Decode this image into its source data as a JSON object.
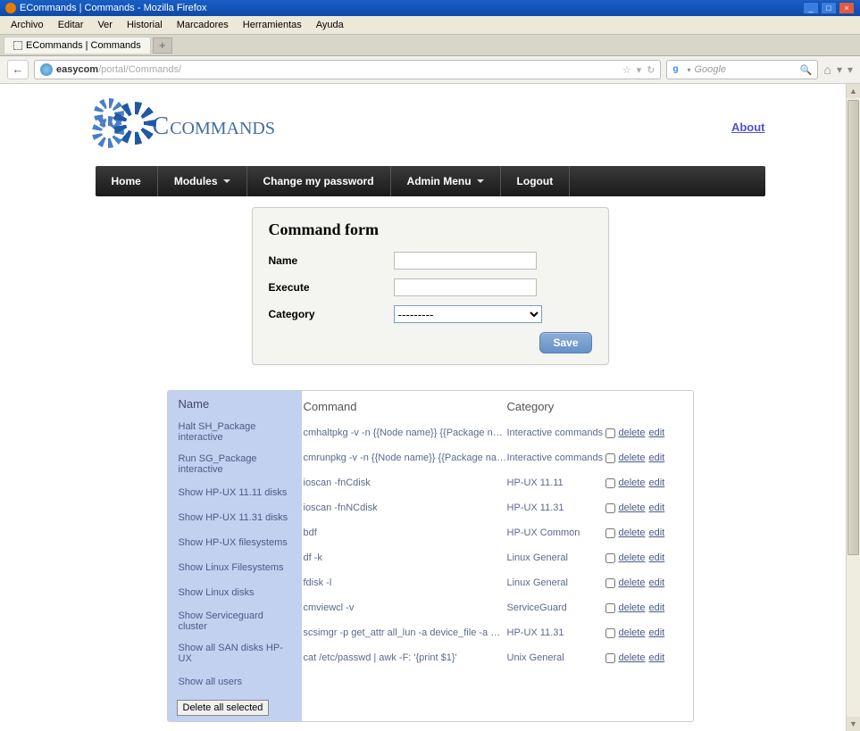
{
  "window": {
    "title": "ECommands | Commands - Mozilla Firefox"
  },
  "menubar": [
    "Archivo",
    "Editar",
    "Ver",
    "Historial",
    "Marcadores",
    "Herramientas",
    "Ayuda"
  ],
  "tab": {
    "title": "ECommands | Commands"
  },
  "url": {
    "host": "easycom",
    "path": "/portal/Commands/"
  },
  "search": {
    "placeholder": "Google"
  },
  "about": "About",
  "logo_text": "Commands",
  "nav": {
    "home": "Home",
    "modules": "Modules",
    "change_pw": "Change my password",
    "admin": "Admin Menu",
    "logout": "Logout"
  },
  "form": {
    "title": "Command form",
    "name_label": "Name",
    "execute_label": "Execute",
    "category_label": "Category",
    "select_default": "---------",
    "save": "Save"
  },
  "table": {
    "hdr_name": "Name",
    "hdr_cmd": "Command",
    "hdr_cat": "Category",
    "delete": "delete",
    "edit": "edit",
    "delete_selected": "Delete all selected",
    "rows": [
      {
        "name": "Halt SH_Package interactive",
        "cmd": "cmhaltpkg -v -n {{Node name}} {{Package name}}",
        "cat": "Interactive commands"
      },
      {
        "name": "Run SG_Package interactive",
        "cmd": "cmrunpkg -v -n {{Node name}} {{Package name}}",
        "cat": "Interactive commands"
      },
      {
        "name": "Show HP-UX 11.11 disks",
        "cmd": "ioscan -fnCdisk",
        "cat": "HP-UX 11.11"
      },
      {
        "name": "Show HP-UX 11.31 disks",
        "cmd": "ioscan -fnNCdisk",
        "cat": "HP-UX 11.31"
      },
      {
        "name": "Show HP-UX filesystems",
        "cmd": "bdf",
        "cat": "HP-UX Common"
      },
      {
        "name": "Show Linux Filesystems",
        "cmd": "df -k",
        "cat": "Linux General"
      },
      {
        "name": "Show Linux disks",
        "cmd": "fdisk -l",
        "cat": "Linux General"
      },
      {
        "name": "Show Serviceguard cluster",
        "cmd": "cmviewcl -v",
        "cat": "ServiceGuard"
      },
      {
        "name": "Show all SAN disks HP-UX",
        "cmd": "scsimgr -p get_attr all_lun -a device_file -a wwid",
        "cat": "HP-UX 11.31"
      },
      {
        "name": "Show all users",
        "cmd": "cat /etc/passwd | awk -F: '{print $1}'",
        "cat": "Unix General"
      }
    ]
  }
}
